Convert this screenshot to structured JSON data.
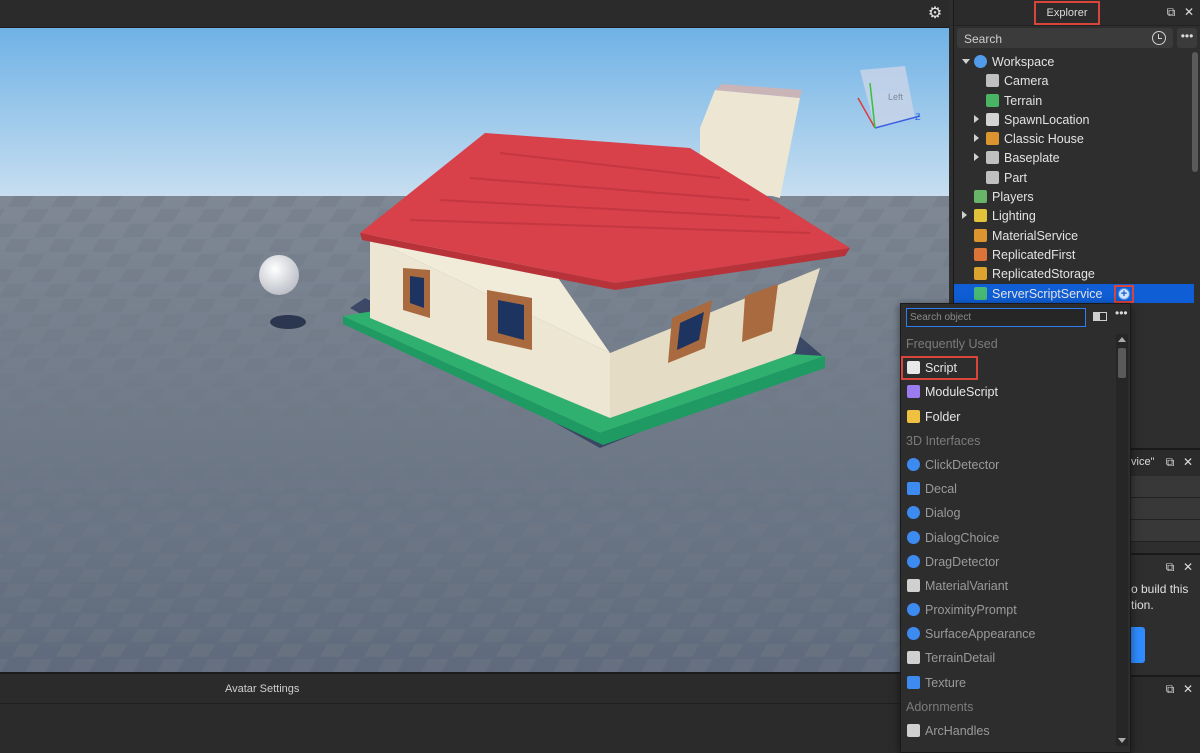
{
  "viewport": {
    "settings_icon": "gear-icon",
    "view_cube_label": "Left",
    "axis_z": "Z"
  },
  "bottom_panel": {
    "title": "Avatar Settings"
  },
  "explorer": {
    "tab_label": "Explorer",
    "search_placeholder": "Search",
    "more_label": "•••",
    "tree": [
      {
        "label": "Workspace",
        "depth": 0,
        "expand": "down",
        "icon": "globe-icon",
        "color": "#57a6ff"
      },
      {
        "label": "Camera",
        "depth": 1,
        "expand": "none",
        "icon": "camera-icon",
        "color": "#d0d0d0"
      },
      {
        "label": "Terrain",
        "depth": 1,
        "expand": "none",
        "icon": "terrain-icon",
        "color": "#4cc46a"
      },
      {
        "label": "SpawnLocation",
        "depth": 1,
        "expand": "right",
        "icon": "spawn-icon",
        "color": "#e6e6e6"
      },
      {
        "label": "Classic House",
        "depth": 1,
        "expand": "right",
        "icon": "model-icon",
        "color": "#f0a030"
      },
      {
        "label": "Baseplate",
        "depth": 1,
        "expand": "right",
        "icon": "part-icon",
        "color": "#d0d0d0"
      },
      {
        "label": "Part",
        "depth": 1,
        "expand": "none",
        "icon": "part-icon",
        "color": "#d0d0d0"
      },
      {
        "label": "Players",
        "depth": 0,
        "expand": "none",
        "icon": "players-icon",
        "color": "#6fc36f"
      },
      {
        "label": "Lighting",
        "depth": 0,
        "expand": "right",
        "icon": "lightbulb-icon",
        "color": "#f5d33c"
      },
      {
        "label": "MaterialService",
        "depth": 0,
        "expand": "none",
        "icon": "material-service-icon",
        "color": "#f0a030"
      },
      {
        "label": "ReplicatedFirst",
        "depth": 0,
        "expand": "none",
        "icon": "replicated-first-icon",
        "color": "#f07c3c"
      },
      {
        "label": "ReplicatedStorage",
        "depth": 0,
        "expand": "none",
        "icon": "replicated-storage-icon",
        "color": "#f0b030"
      },
      {
        "label": "ServerScriptService",
        "depth": 0,
        "expand": "none",
        "icon": "server-script-service-icon",
        "color": "#4cc46a",
        "selected": true
      }
    ],
    "add_icon": "plus-circle-icon"
  },
  "props_panel": {
    "title": "vice\""
  },
  "panel3": {
    "line1": "o build this",
    "line2": "tion."
  },
  "insert_menu": {
    "search_placeholder": "Search object",
    "more_label": "•••",
    "items": [
      {
        "type": "section",
        "label": "Frequently Used"
      },
      {
        "type": "item",
        "label": "Script",
        "icon": "script-icon",
        "color": "#e8e8e8",
        "highlight": true
      },
      {
        "type": "item",
        "label": "ModuleScript",
        "icon": "module-script-icon",
        "color": "#9a7cf0"
      },
      {
        "type": "item",
        "label": "Folder",
        "icon": "folder-icon",
        "color": "#f0c040"
      },
      {
        "type": "section",
        "label": "3D Interfaces"
      },
      {
        "type": "item",
        "label": "ClickDetector",
        "icon": "click-detector-icon",
        "color": "#3d8bf0",
        "dim": true
      },
      {
        "type": "item",
        "label": "Decal",
        "icon": "decal-icon",
        "color": "#3d8bf0",
        "dim": true
      },
      {
        "type": "item",
        "label": "Dialog",
        "icon": "dialog-icon",
        "color": "#3d8bf0",
        "dim": true
      },
      {
        "type": "item",
        "label": "DialogChoice",
        "icon": "dialog-choice-icon",
        "color": "#3d8bf0",
        "dim": true
      },
      {
        "type": "item",
        "label": "DragDetector",
        "icon": "drag-detector-icon",
        "color": "#3d8bf0",
        "dim": true
      },
      {
        "type": "item",
        "label": "MaterialVariant",
        "icon": "material-variant-icon",
        "color": "#d0d0d0",
        "dim": true
      },
      {
        "type": "item",
        "label": "ProximityPrompt",
        "icon": "proximity-prompt-icon",
        "color": "#3d8bf0",
        "dim": true
      },
      {
        "type": "item",
        "label": "SurfaceAppearance",
        "icon": "surface-appearance-icon",
        "color": "#3d8bf0",
        "dim": true
      },
      {
        "type": "item",
        "label": "TerrainDetail",
        "icon": "terrain-detail-icon",
        "color": "#d0d0d0",
        "dim": true
      },
      {
        "type": "item",
        "label": "Texture",
        "icon": "texture-icon",
        "color": "#3d8bf0",
        "dim": true
      },
      {
        "type": "section",
        "label": "Adornments"
      },
      {
        "type": "item",
        "label": "ArcHandles",
        "icon": "arc-handles-icon",
        "color": "#d0d0d0",
        "dim": true
      }
    ]
  }
}
